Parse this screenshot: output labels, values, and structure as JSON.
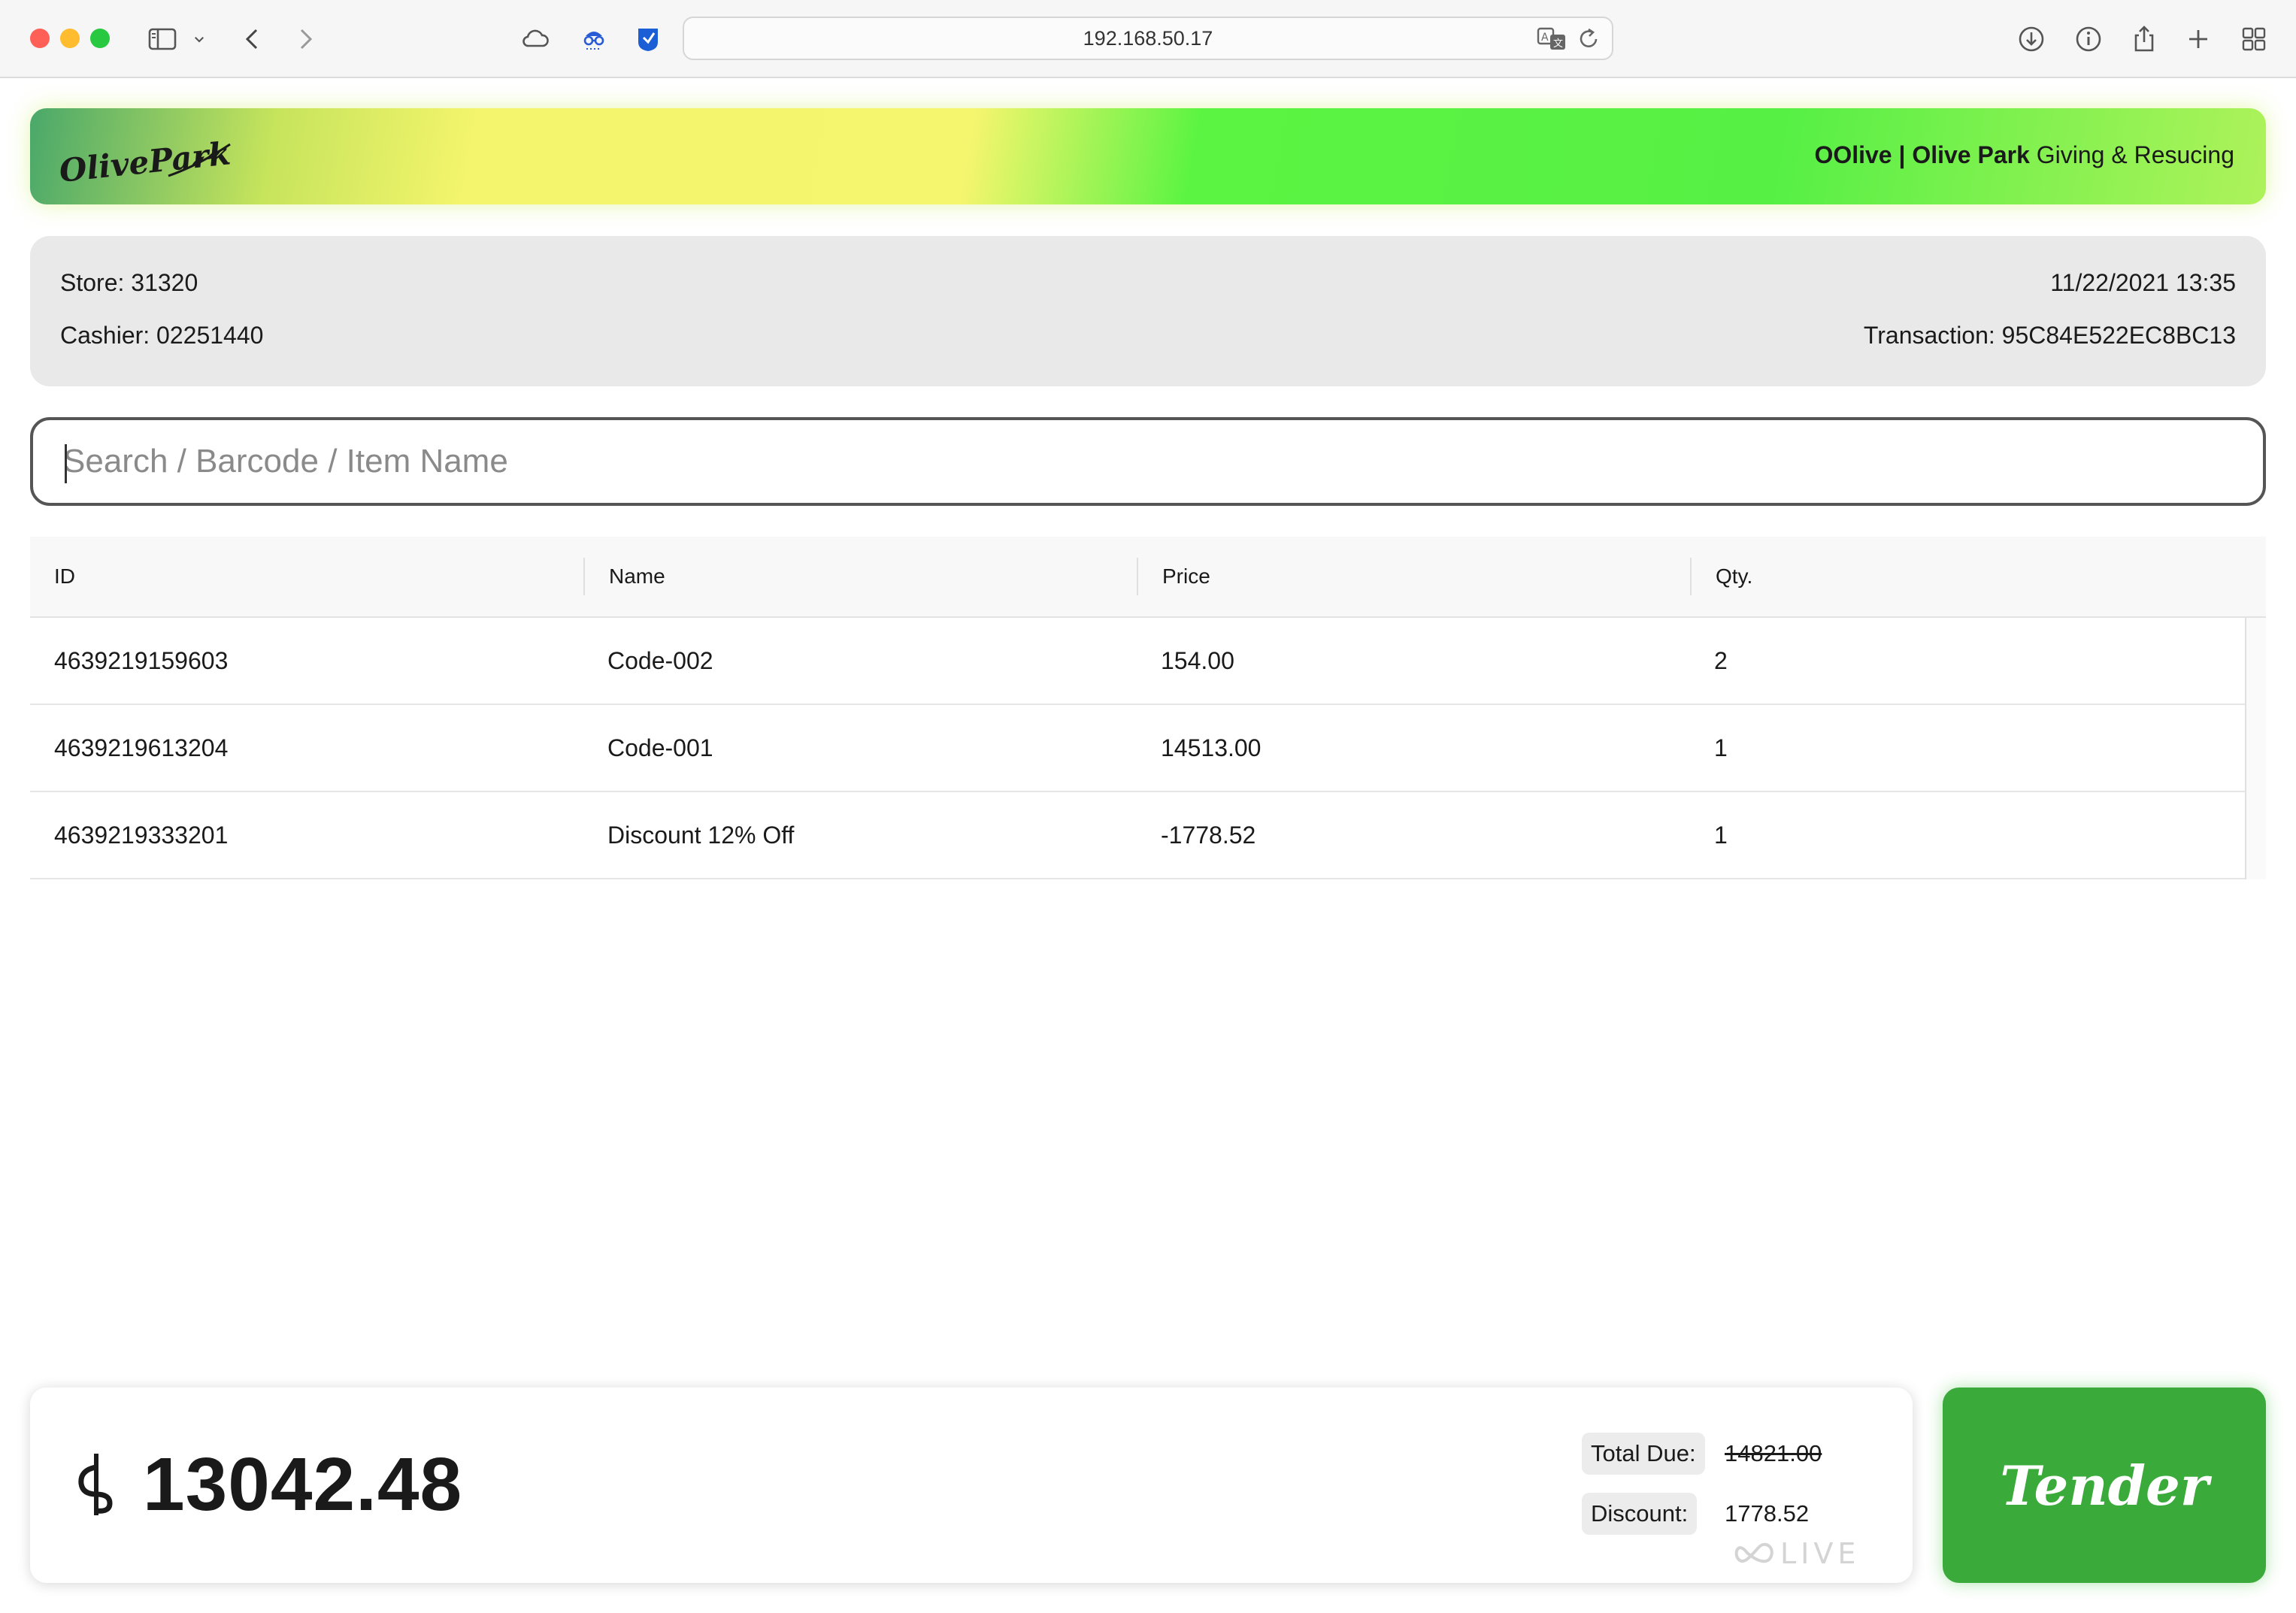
{
  "browser": {
    "url": "192.168.50.17",
    "icons": [
      "sidebar-icon",
      "chevron-down-icon",
      "back-icon",
      "forward-icon",
      "icloud-icon",
      "privacy-icon",
      "shield-extension-icon",
      "translate-icon",
      "reload-icon",
      "download-icon",
      "info-icon",
      "share-icon",
      "new-tab-icon",
      "tab-overview-icon"
    ]
  },
  "banner": {
    "logo_text": "OlivePark",
    "brand_bold": "OOlive | Olive Park",
    "brand_tagline": " Giving & Resucing"
  },
  "info": {
    "store": "Store: 31320",
    "cashier": "Cashier: 02251440",
    "datetime": "11/22/2021 13:35",
    "transaction": "Transaction: 95C84E522EC8BC13"
  },
  "search": {
    "placeholder": "Search / Barcode / Item Name",
    "value": ""
  },
  "table": {
    "columns": [
      "ID",
      "Name",
      "Price",
      "Qty."
    ],
    "rows": [
      {
        "id": "4639219159603",
        "name": "Code-002",
        "price": "154.00",
        "qty": "2"
      },
      {
        "id": "4639219613204",
        "name": "Code-001",
        "price": "14513.00",
        "qty": "1"
      },
      {
        "id": "4639219333201",
        "name": "Discount 12% Off",
        "price": "-1778.52",
        "qty": "1"
      }
    ]
  },
  "totals": {
    "currency_icon": "baht-sign-icon",
    "amount": "13042.48",
    "total_due_label": "Total Due:",
    "total_due_value": "14821.00",
    "discount_label": "Discount:",
    "discount_value": "1778.52",
    "watermark": "OOLIVE"
  },
  "tender_label": "Tender",
  "colors": {
    "tender": "#3aaa3a",
    "banner_yellow": "#f5f56e",
    "banner_green": "#56f045",
    "info_bg": "#e9e9e9"
  }
}
